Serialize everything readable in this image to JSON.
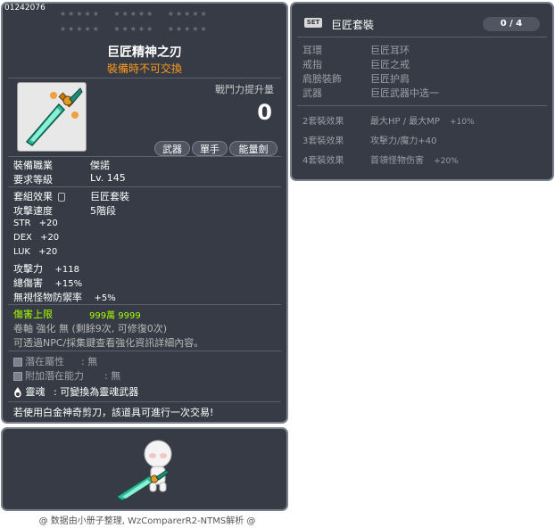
{
  "item": {
    "id": "01242076",
    "stars_row1": [
      "★★★★★",
      "★★★★★",
      "★★★★★"
    ],
    "stars_row2": [
      "★★★★★",
      "★★★★★",
      "★★★★★"
    ],
    "name": "巨匠精神之刃",
    "trade_note": "裝備時不可交換",
    "cp_label": "戰鬥力提升量",
    "cp_value": "0",
    "tags": [
      "武器",
      "單手",
      "能量劍"
    ],
    "job_label": "裝備職業",
    "job_value": "傑諾",
    "level_label": "要求等級",
    "level_value": "Lv. 145",
    "set_effect_label": "套組效果",
    "set_effect_value": "巨匠套裝",
    "attack_speed_label": "攻擊速度",
    "attack_speed_value": "5階段",
    "stats": [
      {
        "name": "STR",
        "value": "+20"
      },
      {
        "name": "DEX",
        "value": "+20"
      },
      {
        "name": "LUK",
        "value": "+20"
      },
      {
        "name": "攻擊力",
        "value": "+118"
      },
      {
        "name": "總傷害",
        "value": "+15%"
      },
      {
        "name": "無視怪物防禦率",
        "value": "+5%"
      }
    ],
    "damage_cap_label": "傷害上限",
    "damage_cap_value": "999萬 9999",
    "scroll_line": "卷軸 強化 無 (剩餘9次, 可修復0次)",
    "npc_line": "可透過NPC/採集鍵查看強化資訊詳細內容。",
    "potential_label": "潛在屬性",
    "potential_value": ": 無",
    "bonus_potential_label": "附加潛在能力",
    "bonus_potential_value": ": 無",
    "soul_label": "靈魂",
    "soul_value": ": 可變換為靈魂武器",
    "platinum_line": "若使用白金神奇剪刀，該道具可進行一次交易!"
  },
  "set": {
    "badge": "SET",
    "name": "巨匠套裝",
    "count": "0 / 4",
    "pieces": [
      {
        "slot": "耳環",
        "name": "巨匠耳环"
      },
      {
        "slot": "戒指",
        "name": "巨匠之戒"
      },
      {
        "slot": "肩膀裝飾",
        "name": "巨匠护肩"
      },
      {
        "slot": "武器",
        "name": "巨匠武器中选一"
      }
    ],
    "effects": [
      {
        "tier": "2套裝效果",
        "text": "最大HP / 最大MP",
        "bonus": "+10%"
      },
      {
        "tier": "3套裝效果",
        "text": "攻擊力/魔力+40",
        "bonus": ""
      },
      {
        "tier": "4套裝效果",
        "text": "首領怪物伤害",
        "bonus": "+20%"
      }
    ]
  },
  "footer": "@ 数据由小册子整理, WzComparerR2-NTMS解析 @",
  "colors": {
    "panel_bg": "#363b45",
    "panel_border": "#7b818c",
    "trade_note": "#ff9a1c",
    "damage_cap": "#aaff00"
  },
  "icons": {
    "weapon": "energy-sword-icon",
    "soul": "soul-flame-icon",
    "set_badge": "set-badge-icon"
  }
}
